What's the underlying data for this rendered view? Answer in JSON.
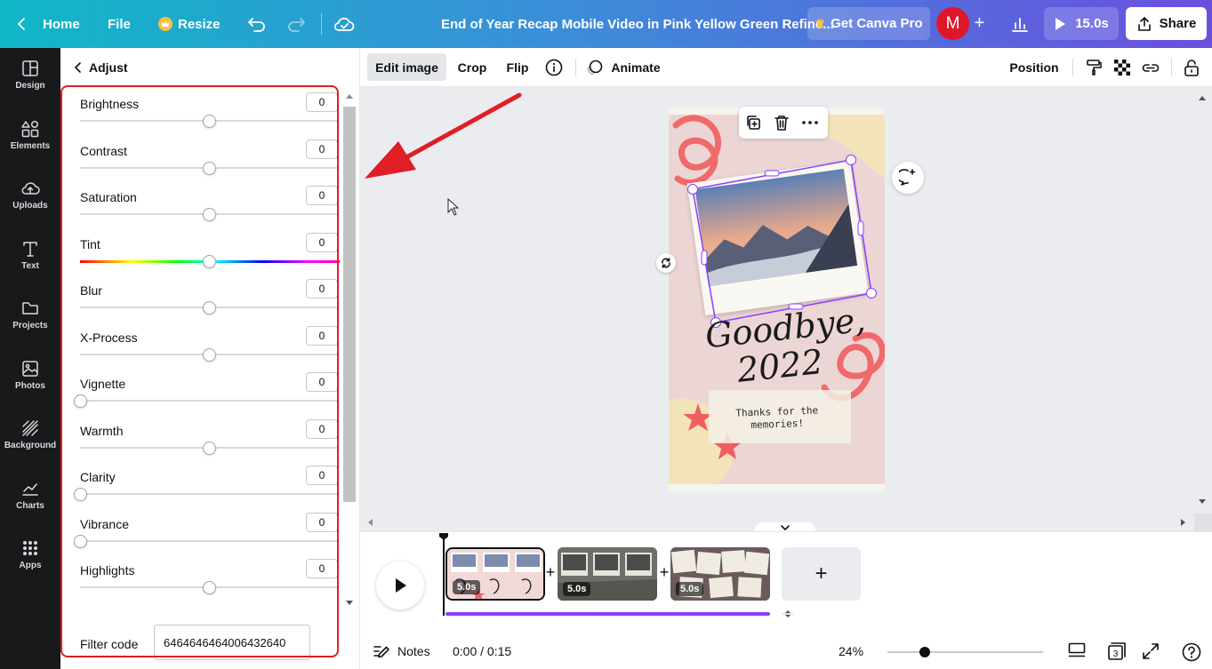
{
  "topbar": {
    "home": "Home",
    "file": "File",
    "resize": "Resize",
    "title": "End of Year Recap Mobile Video in Pink Yellow Green Refine...",
    "get_pro": "Get Canva Pro",
    "avatar_letter": "M",
    "play_duration": "15.0s",
    "share": "Share"
  },
  "rail": [
    {
      "label": "Design",
      "icon": "design-icon"
    },
    {
      "label": "Elements",
      "icon": "elements-icon"
    },
    {
      "label": "Uploads",
      "icon": "uploads-icon"
    },
    {
      "label": "Text",
      "icon": "text-icon"
    },
    {
      "label": "Projects",
      "icon": "projects-icon"
    },
    {
      "label": "Photos",
      "icon": "photos-icon"
    },
    {
      "label": "Background",
      "icon": "background-icon"
    },
    {
      "label": "Charts",
      "icon": "charts-icon"
    },
    {
      "label": "Apps",
      "icon": "apps-icon"
    }
  ],
  "panel": {
    "back_label": "Adjust",
    "adjustments": [
      {
        "label": "Brightness",
        "value": "0",
        "slider_position": 0.5
      },
      {
        "label": "Contrast",
        "value": "0",
        "slider_position": 0.5
      },
      {
        "label": "Saturation",
        "value": "0",
        "slider_position": 0.5
      },
      {
        "label": "Tint",
        "value": "0",
        "slider_position": 0.5
      },
      {
        "label": "Blur",
        "value": "0",
        "slider_position": 0.5
      },
      {
        "label": "X-Process",
        "value": "0",
        "slider_position": 0.5
      },
      {
        "label": "Vignette",
        "value": "0",
        "slider_position": 0
      },
      {
        "label": "Warmth",
        "value": "0",
        "slider_position": 0.5
      },
      {
        "label": "Clarity",
        "value": "0",
        "slider_position": 0
      },
      {
        "label": "Vibrance",
        "value": "0",
        "slider_position": 0
      },
      {
        "label": "Highlights",
        "value": "0",
        "slider_position": 0.5
      }
    ],
    "filter_code_label": "Filter code",
    "filter_code_value": "6464646464006432640"
  },
  "toolbar": {
    "edit_image": "Edit image",
    "crop": "Crop",
    "flip": "Flip",
    "animate": "Animate",
    "position": "Position"
  },
  "design": {
    "headline_1": "Goodbye,",
    "headline_2": "2022",
    "note": "Thanks for the memories!"
  },
  "timeline": {
    "clips": [
      {
        "duration": "5.0s"
      },
      {
        "duration": "5.0s"
      },
      {
        "duration": "5.0s"
      }
    ]
  },
  "footer": {
    "notes": "Notes",
    "time": "0:00 / 0:15",
    "zoom": "24%",
    "zoom_level": 0.24,
    "pages": "3"
  },
  "colors": {
    "accent_purple": "#8b3dff",
    "highlight_red": "#e01e25"
  }
}
